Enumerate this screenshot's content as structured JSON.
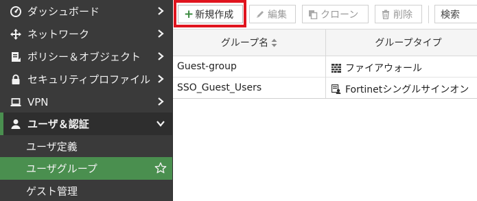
{
  "sidebar": {
    "items": [
      {
        "label": "ダッシュボード",
        "icon": "dashboard-icon"
      },
      {
        "label": "ネットワーク",
        "icon": "network-move-icon"
      },
      {
        "label": "ポリシー＆オブジェクト",
        "icon": "policy-document-icon"
      },
      {
        "label": "セキュリティプロファイル",
        "icon": "lock-icon"
      },
      {
        "label": "VPN",
        "icon": "laptop-icon"
      },
      {
        "label": "ユーザ＆認証",
        "icon": "user-icon"
      }
    ],
    "sub_items": [
      {
        "label": "ユーザ定義"
      },
      {
        "label": "ユーザグループ"
      },
      {
        "label": "ゲスト管理"
      }
    ],
    "accent_color": "#4a8f4f"
  },
  "toolbar": {
    "create_label": "新規作成",
    "edit_label": "編集",
    "clone_label": "クローン",
    "delete_label": "削除",
    "search_placeholder": "検索",
    "highlight_color": "#e0141e"
  },
  "table": {
    "columns": [
      "グループ名",
      "グループタイプ"
    ],
    "rows": [
      {
        "name": "Guest-group",
        "type": "ファイアウォール",
        "type_icon": "firewall-icon"
      },
      {
        "name": "SSO_Guest_Users",
        "type": "Fortinetシングルサインオン",
        "type_icon": "fsso-icon"
      }
    ]
  }
}
